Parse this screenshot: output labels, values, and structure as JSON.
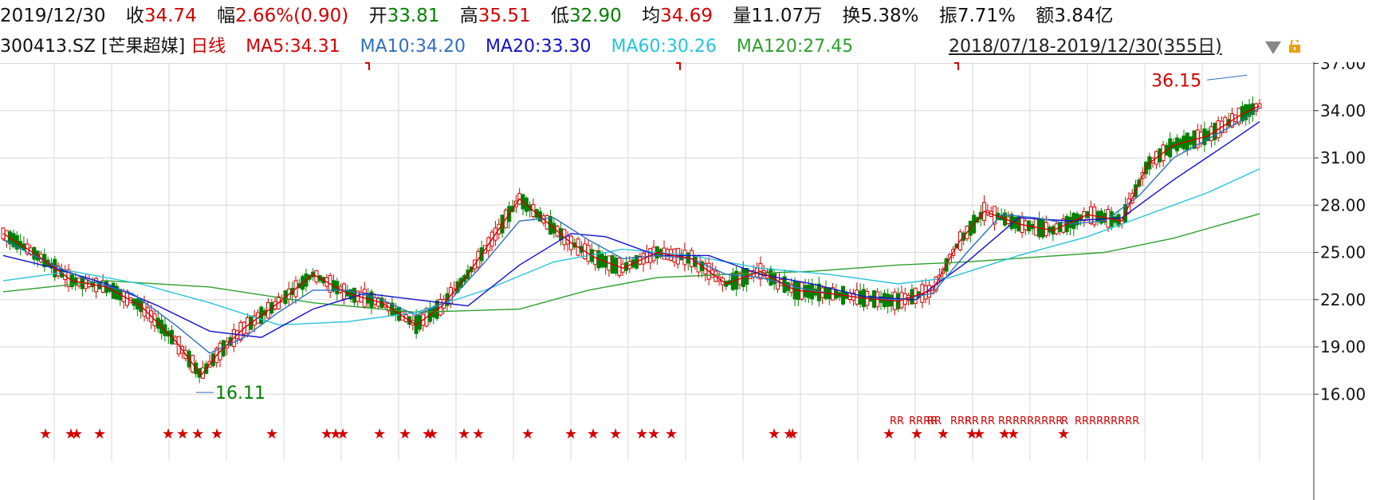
{
  "header": {
    "date": "2019/12/30",
    "close_label": "收",
    "close_value": "34.74",
    "change_label": "幅",
    "change_value": "2.66%(0.90)",
    "open_label": "开",
    "open_value": "33.81",
    "high_label": "高",
    "high_value": "35.51",
    "low_label": "低",
    "low_value": "32.90",
    "avg_label": "均",
    "avg_value": "34.69",
    "volume_label": "量",
    "volume_value": "11.07万",
    "turnover_label": "换",
    "turnover_value": "5.38%",
    "amplitude_label": "振",
    "amplitude_value": "7.71%",
    "amount_label": "额",
    "amount_value": "3.84亿"
  },
  "indicator": {
    "code": "300413.SZ [芒果超媒]",
    "period": "日线",
    "ma5": "MA5:34.31",
    "ma10": "MA10:34.20",
    "ma20": "MA20:33.30",
    "ma60": "MA60:30.26",
    "ma120": "MA120:27.45",
    "range": "2018/07/18-2019/12/30(355日)"
  },
  "colors": {
    "up": "#d40000",
    "down": "#008000",
    "ma5": "#d40000",
    "ma10": "#2f6fc0",
    "ma20": "#1010d0",
    "ma60": "#25c4dc",
    "ma120": "#2ca02c",
    "grid": "#d8d8d8"
  },
  "chart_data": {
    "type": "candlestick",
    "ylim": [
      14.5,
      38.0
    ],
    "yticks": [
      "37.00",
      "34.00",
      "31.00",
      "28.00",
      "25.00",
      "22.00",
      "19.00",
      "16.00"
    ],
    "annotations": {
      "high_label": "36.15",
      "low_label": "16.11"
    },
    "ma_series": {
      "ma5": [
        [
          0,
          26.2
        ],
        [
          20,
          24.8
        ],
        [
          40,
          23.2
        ],
        [
          60,
          22.8
        ],
        [
          80,
          21.6
        ],
        [
          100,
          19.4
        ],
        [
          115,
          17.2
        ],
        [
          125,
          18.6
        ],
        [
          140,
          20.2
        ],
        [
          160,
          21.8
        ],
        [
          180,
          23.6
        ],
        [
          200,
          22.4
        ],
        [
          220,
          21.8
        ],
        [
          240,
          20.4
        ],
        [
          255,
          21.6
        ],
        [
          270,
          23.6
        ],
        [
          285,
          26.0
        ],
        [
          300,
          28.4
        ],
        [
          315,
          27.0
        ],
        [
          330,
          25.6
        ],
        [
          345,
          24.6
        ],
        [
          360,
          24.0
        ],
        [
          380,
          25.0
        ],
        [
          400,
          24.6
        ],
        [
          420,
          23.0
        ],
        [
          440,
          23.8
        ],
        [
          460,
          22.6
        ],
        [
          480,
          22.4
        ],
        [
          500,
          22.1
        ],
        [
          520,
          21.9
        ],
        [
          540,
          22.6
        ],
        [
          555,
          25.6
        ],
        [
          570,
          27.6
        ],
        [
          590,
          26.8
        ],
        [
          610,
          26.4
        ],
        [
          630,
          27.4
        ],
        [
          650,
          27.0
        ],
        [
          665,
          30.6
        ],
        [
          680,
          31.8
        ],
        [
          700,
          32.4
        ],
        [
          720,
          33.8
        ],
        [
          730,
          34.3
        ]
      ],
      "ma10": [
        [
          0,
          25.8
        ],
        [
          25,
          24.4
        ],
        [
          50,
          23.2
        ],
        [
          75,
          22.4
        ],
        [
          100,
          20.4
        ],
        [
          120,
          18.6
        ],
        [
          140,
          19.6
        ],
        [
          160,
          21.2
        ],
        [
          180,
          22.6
        ],
        [
          200,
          22.6
        ],
        [
          220,
          22.0
        ],
        [
          240,
          21.0
        ],
        [
          260,
          22.0
        ],
        [
          280,
          24.4
        ],
        [
          300,
          27.0
        ],
        [
          320,
          27.2
        ],
        [
          340,
          25.8
        ],
        [
          360,
          24.6
        ],
        [
          380,
          24.8
        ],
        [
          400,
          24.6
        ],
        [
          420,
          23.6
        ],
        [
          440,
          23.4
        ],
        [
          460,
          22.8
        ],
        [
          480,
          22.4
        ],
        [
          500,
          22.1
        ],
        [
          520,
          22.0
        ],
        [
          540,
          22.4
        ],
        [
          560,
          25.0
        ],
        [
          580,
          27.4
        ],
        [
          600,
          27.2
        ],
        [
          620,
          26.8
        ],
        [
          640,
          27.0
        ],
        [
          660,
          28.6
        ],
        [
          680,
          31.0
        ],
        [
          700,
          32.2
        ],
        [
          720,
          33.4
        ],
        [
          730,
          34.2
        ]
      ],
      "ma20": [
        [
          0,
          24.8
        ],
        [
          30,
          24.0
        ],
        [
          60,
          23.0
        ],
        [
          90,
          21.6
        ],
        [
          120,
          20.0
        ],
        [
          150,
          19.6
        ],
        [
          180,
          21.4
        ],
        [
          210,
          22.4
        ],
        [
          240,
          22.0
        ],
        [
          270,
          21.6
        ],
        [
          300,
          24.2
        ],
        [
          330,
          26.2
        ],
        [
          350,
          26.0
        ],
        [
          380,
          24.8
        ],
        [
          410,
          24.8
        ],
        [
          440,
          23.6
        ],
        [
          470,
          23.0
        ],
        [
          500,
          22.2
        ],
        [
          530,
          22.0
        ],
        [
          560,
          24.4
        ],
        [
          590,
          27.2
        ],
        [
          620,
          27.0
        ],
        [
          650,
          27.2
        ],
        [
          680,
          29.6
        ],
        [
          710,
          31.8
        ],
        [
          730,
          33.3
        ]
      ],
      "ma60": [
        [
          0,
          23.2
        ],
        [
          40,
          23.8
        ],
        [
          80,
          23.0
        ],
        [
          120,
          21.8
        ],
        [
          160,
          20.4
        ],
        [
          200,
          20.6
        ],
        [
          240,
          21.2
        ],
        [
          280,
          22.6
        ],
        [
          320,
          24.4
        ],
        [
          360,
          25.2
        ],
        [
          400,
          24.8
        ],
        [
          440,
          24.0
        ],
        [
          480,
          23.6
        ],
        [
          520,
          23.0
        ],
        [
          550,
          23.4
        ],
        [
          590,
          24.8
        ],
        [
          630,
          26.0
        ],
        [
          670,
          27.6
        ],
        [
          700,
          28.8
        ],
        [
          730,
          30.3
        ]
      ],
      "ma120": [
        [
          0,
          22.5
        ],
        [
          60,
          23.2
        ],
        [
          120,
          22.8
        ],
        [
          180,
          21.8
        ],
        [
          240,
          21.2
        ],
        [
          300,
          21.4
        ],
        [
          340,
          22.6
        ],
        [
          380,
          23.4
        ],
        [
          420,
          23.6
        ],
        [
          470,
          23.8
        ],
        [
          520,
          24.2
        ],
        [
          560,
          24.4
        ],
        [
          600,
          24.7
        ],
        [
          640,
          25.0
        ],
        [
          680,
          25.9
        ],
        [
          730,
          27.45
        ]
      ]
    }
  },
  "markers": {
    "star": "★",
    "r_groups": [
      "RR",
      "RRRR",
      "RR",
      "RRR",
      "RR",
      "RR",
      "RRRRRRRRR",
      "R",
      "RRRRRRRRR"
    ]
  }
}
